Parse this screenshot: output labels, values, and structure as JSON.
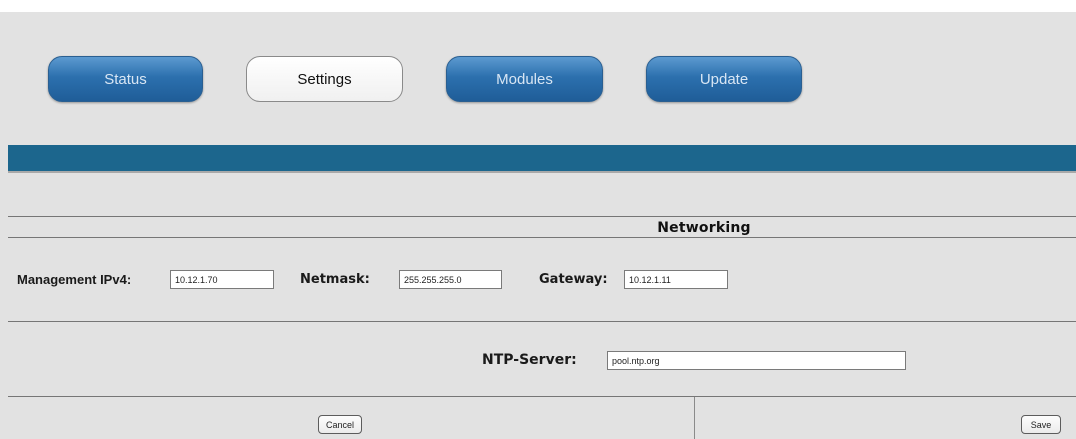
{
  "nav": {
    "tabs": [
      {
        "label": "Status",
        "active": false
      },
      {
        "label": "Settings",
        "active": true
      },
      {
        "label": "Modules",
        "active": false
      },
      {
        "label": "Update",
        "active": false
      }
    ]
  },
  "networking": {
    "title": "Networking",
    "ipv4_label": "Management IPv4:",
    "ipv4_value": "10.12.1.70",
    "netmask_label": "Netmask:",
    "netmask_value": "255.255.255.0",
    "gateway_label": "Gateway:",
    "gateway_value": "10.12.1.11",
    "ntp_label": "NTP-Server:",
    "ntp_value": "pool.ntp.org"
  },
  "actions": {
    "cancel_label": "Cancel",
    "save_label": "Save"
  },
  "colors": {
    "tab_blue": "#2c70ae",
    "banner": "#1c668d",
    "background": "#e2e2e2"
  }
}
